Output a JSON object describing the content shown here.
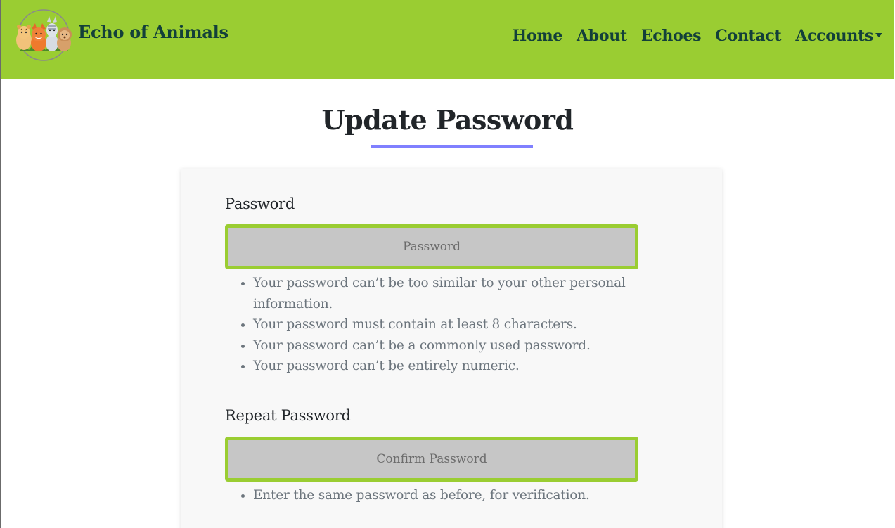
{
  "brand": {
    "name": "Echo of Animals",
    "logo_icon": "animals-logo-icon"
  },
  "nav": {
    "items": [
      {
        "label": "Home"
      },
      {
        "label": "About"
      },
      {
        "label": "Echoes"
      },
      {
        "label": "Contact"
      }
    ],
    "accounts": {
      "label": "Accounts",
      "icon": "caret-down-icon"
    }
  },
  "colors": {
    "navbar_bg": "#9acd32",
    "nav_text": "#13403a",
    "underline": "#8080ff",
    "input_border": "#9acd32",
    "input_bg": "#c6c6c6"
  },
  "page": {
    "title": "Update Password"
  },
  "form": {
    "password": {
      "label": "Password",
      "placeholder": "Password",
      "value": "",
      "help": [
        "Your password can’t be too similar to your other personal information.",
        "Your password must contain at least 8 characters.",
        "Your password can’t be a commonly used password.",
        "Your password can’t be entirely numeric."
      ]
    },
    "repeat": {
      "label": "Repeat Password",
      "placeholder": "Confirm Password",
      "value": "",
      "help": [
        "Enter the same password as before, for verification."
      ]
    }
  }
}
